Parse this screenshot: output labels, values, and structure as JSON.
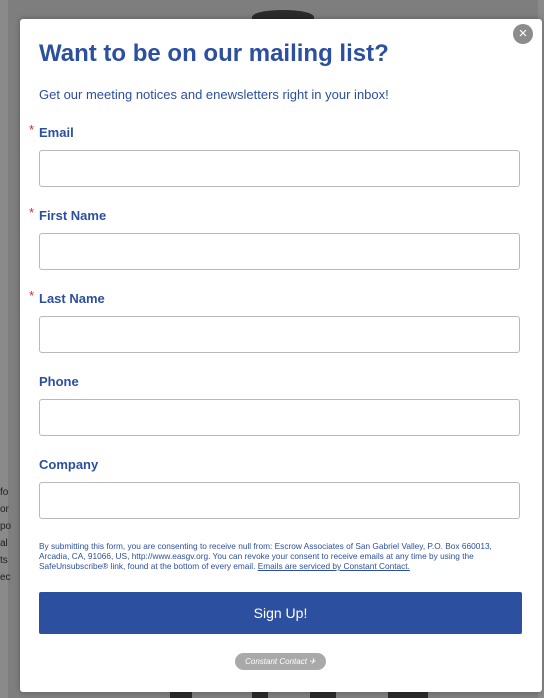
{
  "background": {
    "left_text_fragments": [
      "fo",
      "or",
      "po",
      "al",
      "ts",
      "ec"
    ]
  },
  "modal": {
    "close_icon": "×",
    "title": "Want to be on our mailing list?",
    "subtitle": "Get our meeting notices and enewsletters right in your inbox!",
    "required_mark": "*",
    "fields": [
      {
        "label": "Email",
        "required": true,
        "value": "",
        "placeholder": ""
      },
      {
        "label": "First Name",
        "required": true,
        "value": "",
        "placeholder": ""
      },
      {
        "label": "Last Name",
        "required": true,
        "value": "",
        "placeholder": ""
      },
      {
        "label": "Phone",
        "required": false,
        "value": "",
        "placeholder": ""
      },
      {
        "label": "Company",
        "required": false,
        "value": "",
        "placeholder": ""
      }
    ],
    "consent_text": "By submitting this form, you are consenting to receive null from: Escrow Associates of San Gabriel Valley, P.O. Box 660013, Arcadia, CA, 91066, US, http://www.easgv.org. You can revoke your consent to receive emails at any time by using the SafeUnsubscribe® link, found at the bottom of every email.",
    "consent_link": "Emails are serviced by Constant Contact.",
    "signup_label": "Sign Up!",
    "badge_label": "Constant Contact"
  },
  "colors": {
    "accent": "#2c4f9f",
    "required": "#e0262c",
    "overlay": "#808080"
  }
}
